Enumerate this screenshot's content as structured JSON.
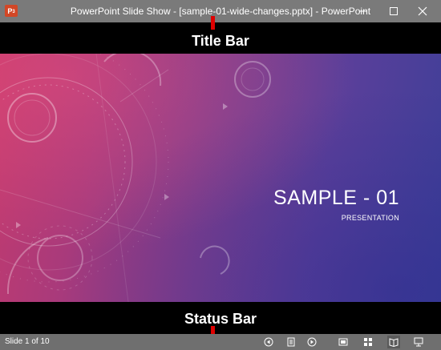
{
  "window": {
    "title": "PowerPoint Slide Show - [sample-01-wide-changes.pptx] - PowerPoint",
    "app_icon_text": "P"
  },
  "callouts": {
    "title_bar": "Title Bar",
    "status_bar": "Status Bar"
  },
  "slide": {
    "title": "SAMPLE - 01",
    "subtitle": "PRESENTATION"
  },
  "status": {
    "slide_counter": "Slide 1 of 10"
  },
  "icons": {
    "status_buttons": [
      "previous-icon",
      "slide-menu-icon",
      "next-icon",
      "presenter-view-icon",
      "slide-sorter-icon",
      "reading-view-icon",
      "slide-show-icon"
    ]
  },
  "colors": {
    "title_bar": "#7a7a7a",
    "status_bar": "#6f6f6f",
    "callout_marker": "#e00000",
    "app_icon": "#d24726"
  }
}
